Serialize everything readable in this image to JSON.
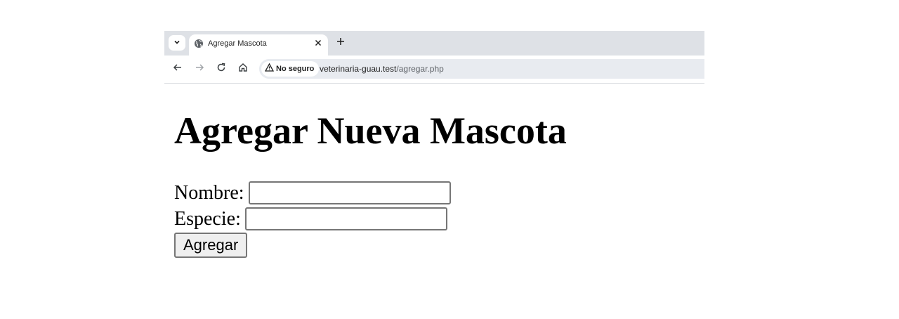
{
  "browser": {
    "tab": {
      "title": "Agregar Mascota"
    },
    "address_bar": {
      "security_label": "No seguro",
      "url_host": "veterinaria-guau.test",
      "url_path": "/agregar.php"
    }
  },
  "page": {
    "title": "Agregar Nueva Mascota",
    "form": {
      "name_label": "Nombre:",
      "name_value": "",
      "species_label": "Especie:",
      "species_value": "",
      "submit_label": "Agregar"
    }
  }
}
